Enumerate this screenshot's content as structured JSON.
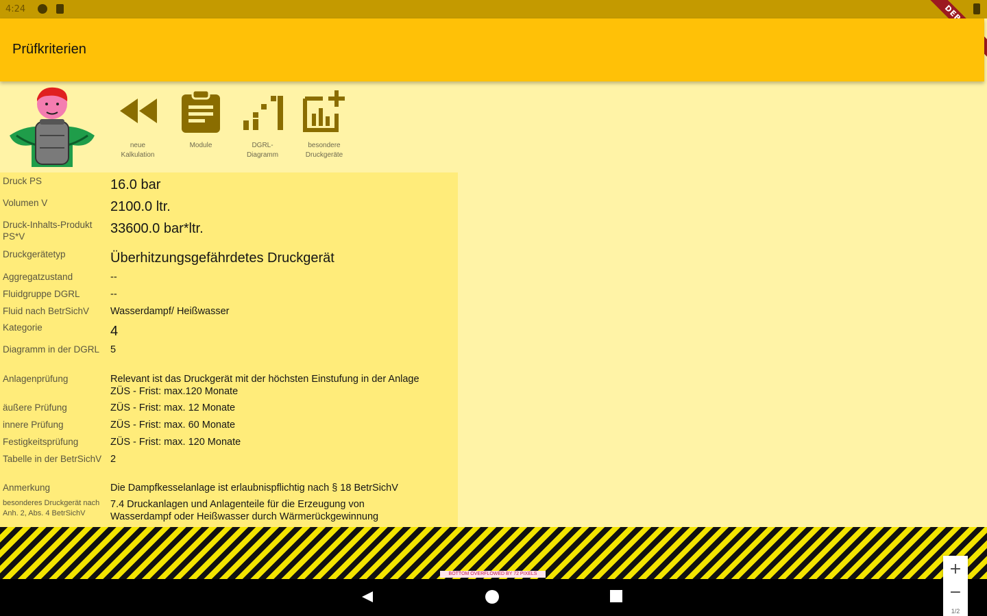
{
  "status_bar": {
    "time": "4:24"
  },
  "debug_banner": "DEBUG",
  "app_bar": {
    "title": "Prüfkriterien"
  },
  "toolbar": {
    "items": [
      {
        "label": "neue Kalkulation",
        "icon": "rewind-icon"
      },
      {
        "label": "Module",
        "icon": "clipboard-icon"
      },
      {
        "label": "DGRL-Diagramm",
        "icon": "chart-steps-icon"
      },
      {
        "label": "besondere Druckgeräte",
        "icon": "add-chart-icon"
      }
    ]
  },
  "rows": [
    {
      "label": "Druck PS",
      "value": "16.0 bar"
    },
    {
      "label": "Volumen V",
      "value": "2100.0 ltr."
    },
    {
      "label": "Druck-Inhalts-Produkt PS*V",
      "value": "33600.0 bar*ltr."
    },
    {
      "label": "Druckgerätetyp",
      "value": "Überhitzungsgefährdetes Druckgerät"
    },
    {
      "label": "Aggregatzustand",
      "value": "--"
    },
    {
      "label": "Fluidgruppe DGRL",
      "value": "--"
    },
    {
      "label": "Fluid nach BetrSichV",
      "value": "Wasserdampf/ Heißwasser"
    },
    {
      "label": "Kategorie",
      "value": "4"
    },
    {
      "label": "Diagramm in der DGRL",
      "value": "5"
    },
    {
      "label": "Anlagenprüfung",
      "value": "Relevant ist das Druckgerät mit der höchsten Einstufung in der Anlage",
      "value2": "ZÜS - Frist: max.120 Monate"
    },
    {
      "label": "äußere Prüfung",
      "value": "ZÜS - Frist: max. 12 Monate"
    },
    {
      "label": "innere Prüfung",
      "value": "ZÜS - Frist: max. 60 Monate"
    },
    {
      "label": "Festigkeitsprüfung",
      "value": "ZÜS - Frist: max. 120 Monate"
    },
    {
      "label": "Tabelle in der BetrSichV",
      "value": "2"
    },
    {
      "label": "Anmerkung",
      "value": "Die Dampfkesselanlage ist erlaubnispflichtig nach § 18 BetrSichV"
    },
    {
      "label": "besonderes Druckgerät nach Anh. 2, Abs. 4 BetrSichV",
      "value": "7.4 Druckanlagen und Anlagenteile für die Erzeugung von",
      "value2": "Wasserdampf oder Heißwasser durch Wärmerückgewinnung"
    }
  ],
  "overflow_note": "BOTTOM OVERFLOWED BY 72 PIXELS",
  "zoom": {
    "plus": "+",
    "minus": "−",
    "text": "1/2"
  },
  "colors": {
    "app_bar": "#ffc107",
    "status_bar": "#c49a00",
    "background": "#fff3a6",
    "panel": "#ffec7a"
  }
}
